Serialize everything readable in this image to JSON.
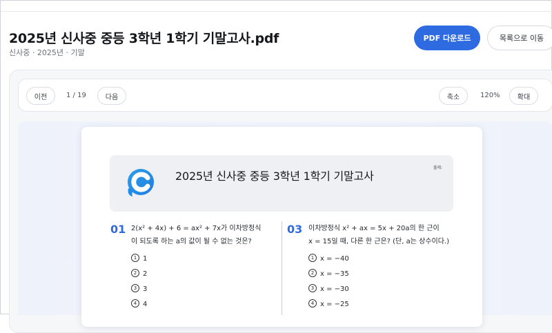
{
  "header": {
    "title": "2025년 신사중 중등 3학년 1학기 기말고사.pdf",
    "breadcrumb": "신사중 · 2025년 · 기말",
    "download_label": "PDF 다운로드",
    "list_label": "목록으로 이동"
  },
  "toolbar": {
    "prev_label": "이전",
    "page_indicator": "1 / 19",
    "next_label": "다음",
    "zoom_out_label": "축소",
    "zoom_level": "120%",
    "zoom_in_label": "확대"
  },
  "document": {
    "exam_title": "2025년 신사중 중등 3학년 1학기 기말고사",
    "sign_label": "출제:",
    "questions": [
      {
        "number": "01",
        "line1": "2(x² + 4x) + 6 = ax² + 7x가 이차방정식",
        "line2": "이 되도록 하는 a의 값이 될 수 없는 것은?",
        "choices": [
          {
            "mark": "1",
            "value": "1"
          },
          {
            "mark": "2",
            "value": "2"
          },
          {
            "mark": "3",
            "value": "3"
          },
          {
            "mark": "4",
            "value": "4"
          }
        ]
      },
      {
        "number": "03",
        "line1": "이차방정식 x² + ax = 5x + 20a의 한 근이",
        "line2": "x = 15일 때, 다른 한 근은? (단, a는 상수이다.)",
        "choices": [
          {
            "mark": "1",
            "value": "x = −40"
          },
          {
            "mark": "2",
            "value": "x = −35"
          },
          {
            "mark": "3",
            "value": "x = −30"
          },
          {
            "mark": "4",
            "value": "x = −25"
          }
        ]
      }
    ]
  },
  "colors": {
    "accent": "#2f6be0",
    "logo_blue": "#1f8be6",
    "logo_light": "#39b3f0"
  },
  "icons": {
    "logo": "brand-c-logo"
  }
}
